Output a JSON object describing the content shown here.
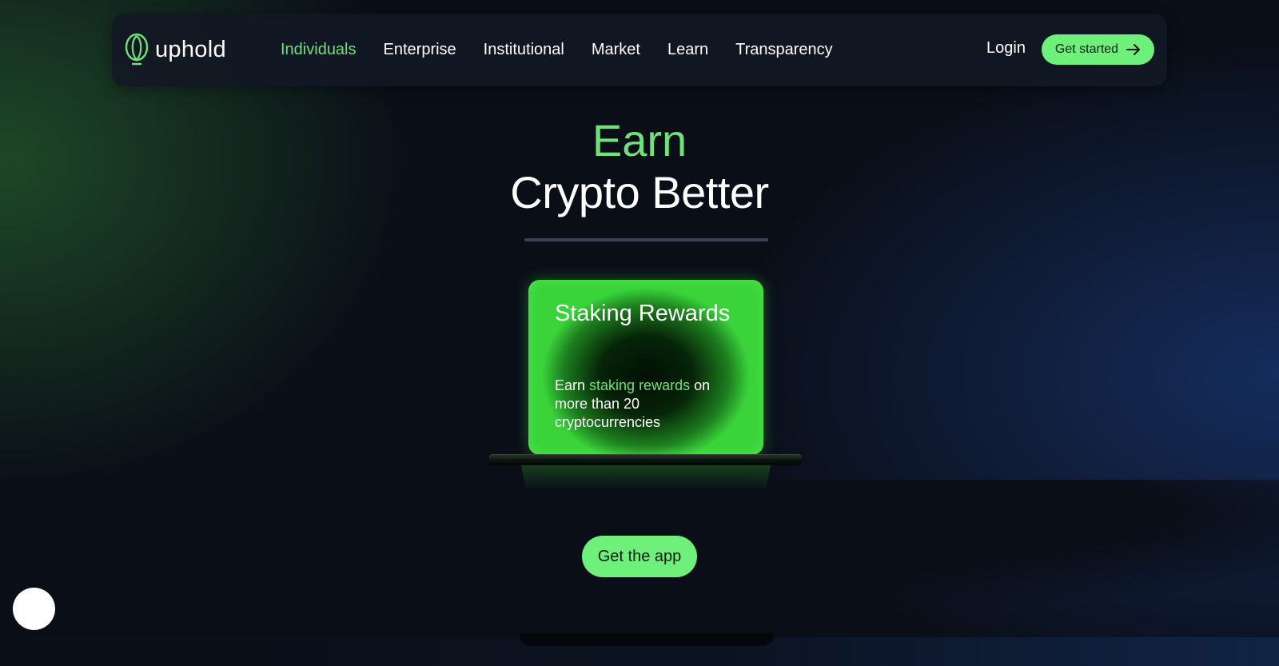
{
  "brand": {
    "name": "uphold",
    "accent_color": "#6ef07a",
    "logo_icon": "uphold-logo-icon"
  },
  "nav": {
    "items": [
      {
        "label": "Individuals",
        "active": true
      },
      {
        "label": "Enterprise",
        "active": false
      },
      {
        "label": "Institutional",
        "active": false
      },
      {
        "label": "Market",
        "active": false
      },
      {
        "label": "Learn",
        "active": false
      },
      {
        "label": "Transparency",
        "active": false
      }
    ],
    "login_label": "Login",
    "cta_label": "Get started",
    "cta_icon": "arrow-right-icon"
  },
  "hero": {
    "line1": "Earn",
    "line2": "Crypto Better"
  },
  "card": {
    "title": "Staking Rewards",
    "body_prefix": "Earn ",
    "body_highlight": "staking rewards",
    "body_suffix": " on more than 20 cryptocurrencies"
  },
  "app_button_label": "Get the app",
  "chat_widget_icon": "chat-bubble-icon"
}
